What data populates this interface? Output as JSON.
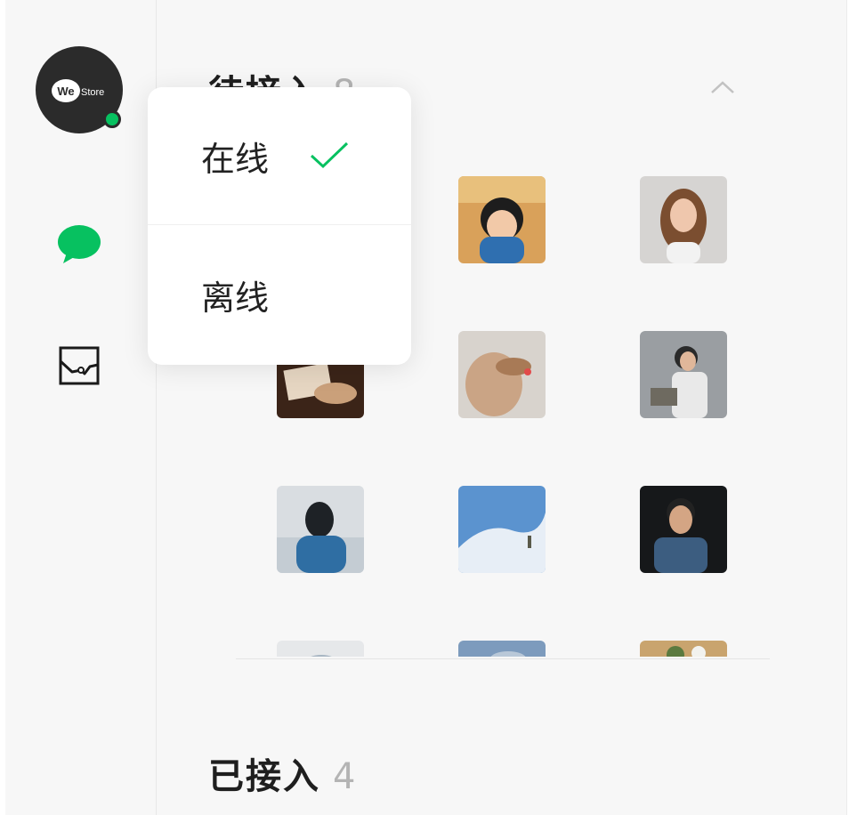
{
  "brand": {
    "logo_text_we": "We",
    "logo_text_store": "Store",
    "online_color": "#07c160"
  },
  "sidebar": {
    "items": [
      {
        "name": "chat",
        "icon": "chat-bubble-icon",
        "active": true,
        "color": "#07c160"
      },
      {
        "name": "stats",
        "icon": "chart-icon",
        "active": false
      }
    ]
  },
  "status_menu": {
    "online_label": "在线",
    "offline_label": "离线",
    "selected": "online",
    "check_color": "#07c160"
  },
  "pending": {
    "title": "待接入",
    "count": "8"
  },
  "accepted": {
    "title": "已接入",
    "count": "4"
  }
}
